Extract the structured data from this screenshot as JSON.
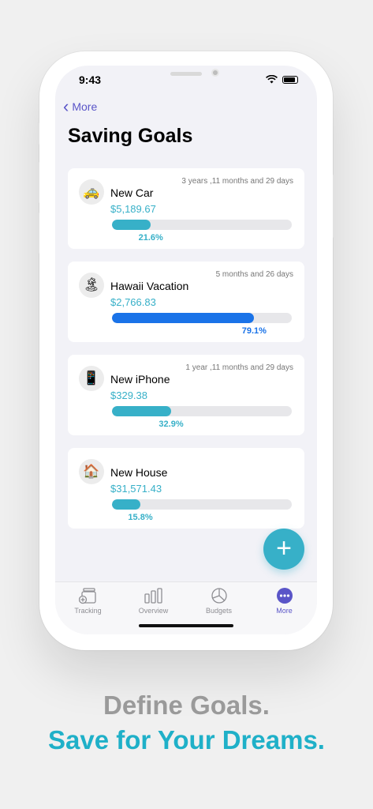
{
  "status": {
    "time": "9:43"
  },
  "nav": {
    "back_label": "More",
    "title": "Saving Goals"
  },
  "goals": [
    {
      "name": "New Car",
      "amount": "$5,189.67",
      "duration": "3 years ,11 months and 29 days",
      "percent_label": "21.6%",
      "progress": 0.216,
      "icon": "🚕",
      "color": "#37b0c8"
    },
    {
      "name": "Hawaii Vacation",
      "amount": "$2,766.83",
      "duration": "5 months and 26 days",
      "percent_label": "79.1%",
      "progress": 0.791,
      "icon": "🏝",
      "color": "#1a73e8"
    },
    {
      "name": "New iPhone",
      "amount": "$329.38",
      "duration": "1 year ,11 months and 29 days",
      "percent_label": "32.9%",
      "progress": 0.329,
      "icon": "📱",
      "color": "#37b0c8"
    },
    {
      "name": "New House",
      "amount": "$31,571.43",
      "duration": "",
      "percent_label": "15.8%",
      "progress": 0.158,
      "icon": "🏠",
      "color": "#37b0c8"
    }
  ],
  "fab": {
    "label": "+"
  },
  "tabbar": {
    "tabs": [
      {
        "label": "Tracking",
        "icon": "tracking-icon"
      },
      {
        "label": "Overview",
        "icon": "overview-icon"
      },
      {
        "label": "Budgets",
        "icon": "budgets-icon"
      },
      {
        "label": "More",
        "icon": "more-icon"
      }
    ],
    "active": "More"
  },
  "tagline": {
    "line1": "Define Goals.",
    "line2": "Save for Your Dreams."
  }
}
